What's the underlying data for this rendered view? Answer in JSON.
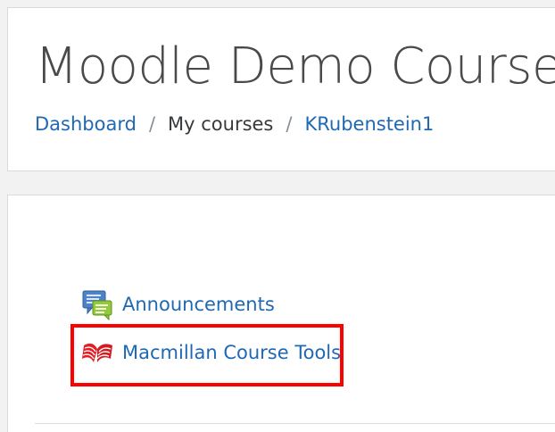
{
  "course": {
    "title": "Moodle Demo Course"
  },
  "breadcrumb": {
    "items": [
      {
        "label": "Dashboard"
      },
      {
        "label": "My courses"
      },
      {
        "label": "KRubenstein1"
      }
    ],
    "separator": "/"
  },
  "activities": [
    {
      "label": "Announcements",
      "icon": "forum-chat-bubbles-icon"
    },
    {
      "label": "Macmillan Course Tools",
      "icon": "macmillan-book-logo-icon"
    }
  ],
  "highlight": {
    "color": "#ff0000",
    "target": "Macmillan Course Tools"
  },
  "colors": {
    "link": "#1f68b4",
    "title": "#4a4a4a",
    "page_background": "#f2f2f2",
    "card_background": "#ffffff"
  }
}
